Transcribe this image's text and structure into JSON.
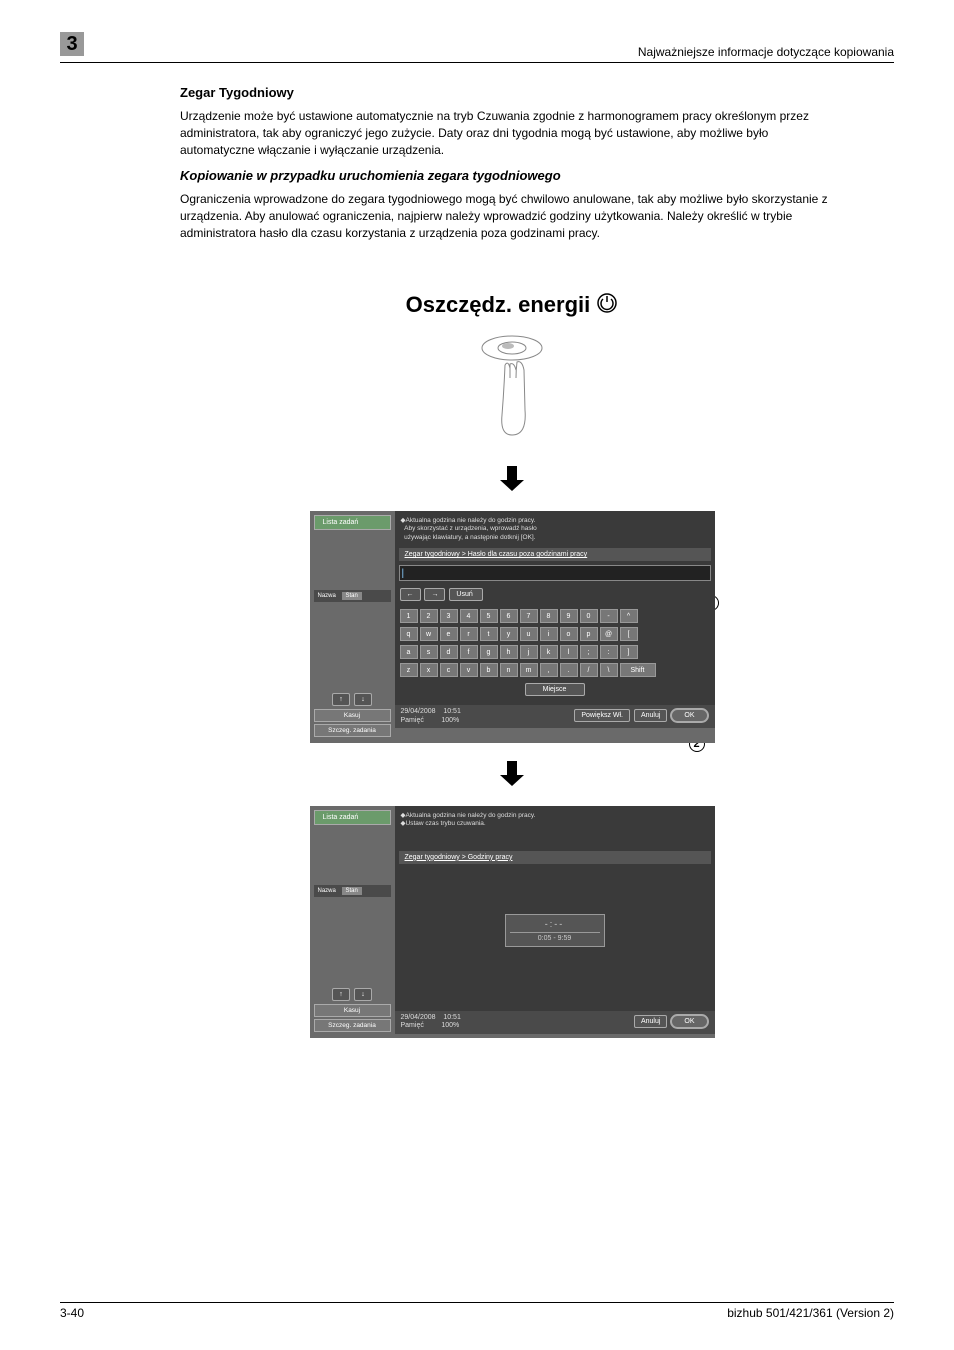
{
  "header": {
    "chapter_num": "3",
    "breadcrumb": "Najważniejsze informacje dotyczące kopiowania"
  },
  "section": {
    "title": "Zegar Tygodniowy",
    "para1": "Urządzenie może być ustawione automatycznie na tryb Czuwania zgodnie z harmonogramem pracy określonym przez administratora, tak aby ograniczyć jego zużycie. Daty oraz dni tygodnia mogą być ustawione, aby możliwe było automatyczne włączanie i wyłączanie urządzenia.",
    "subtitle": "Kopiowanie w przypadku uruchomienia zegara tygodniowego",
    "para2": "Ograniczenia wprowadzone do zegara tygodniowego mogą być chwilowo anulowane, tak aby możliwe było skorzystanie z urządzenia. Aby anulować ograniczenia, najpierw należy wprowadzić godziny użytkowania. Należy określić w trybie administratora hasło dla czasu korzystania z urządzenia poza godzinami pracy.",
    "energy_title": "Oszczędz. energii"
  },
  "screenshot1": {
    "sidebar": {
      "list_btn": "Lista zadań",
      "header1": "Nazwa",
      "header2": "Stan",
      "kasuj": "Kasuj",
      "szczeg": "Szczeg. zadania"
    },
    "info_line1": "Aktualna godzina nie należy do godzin pracy.",
    "info_line2": "Aby skorzystać z urządzenia, wprowadź hasło",
    "info_line3": "używając klawiatury, a następnie dotknij [OK].",
    "breadcrumb": "Zegar tygodniowy > Hasło dla czasu poza godzinami pracy",
    "delete_btn": "Usuń",
    "keys_row1": [
      "1",
      "2",
      "3",
      "4",
      "5",
      "6",
      "7",
      "8",
      "9",
      "0",
      "-",
      "^"
    ],
    "keys_row2": [
      "q",
      "w",
      "e",
      "r",
      "t",
      "y",
      "u",
      "i",
      "o",
      "p",
      "@",
      "["
    ],
    "keys_row3": [
      "a",
      "s",
      "d",
      "f",
      "g",
      "h",
      "j",
      "k",
      "l",
      ";",
      ":",
      "]"
    ],
    "keys_row4": [
      "z",
      "x",
      "c",
      "v",
      "b",
      "n",
      "m",
      ",",
      ".",
      "/",
      "\\"
    ],
    "shift": "Shift",
    "space": "Miejsce",
    "powieksz": "Powiększ Wł.",
    "anuluj": "Anuluj",
    "ok": "OK",
    "date": "29/04/2008",
    "time": "10:51",
    "mem_label": "Pamięć",
    "mem_val": "100%"
  },
  "screenshot2": {
    "sidebar": {
      "list_btn": "Lista zadań",
      "header1": "Nazwa",
      "header2": "Stan",
      "kasuj": "Kasuj",
      "szczeg": "Szczeg. zadania"
    },
    "info_line1": "Aktualna godzina nie należy do godzin pracy.",
    "info_line2": "Ustaw czas trybu czuwania.",
    "breadcrumb": "Zegar tygodniowy > Godziny pracy",
    "time_display": "-:--",
    "time_range": "0:05 - 9:59",
    "anuluj": "Anuluj",
    "ok": "OK",
    "date": "29/04/2008",
    "time": "10:51",
    "mem_label": "Pamięć",
    "mem_val": "100%"
  },
  "footer": {
    "page": "3-40",
    "product": "bizhub 501/421/361 (Version 2)"
  }
}
